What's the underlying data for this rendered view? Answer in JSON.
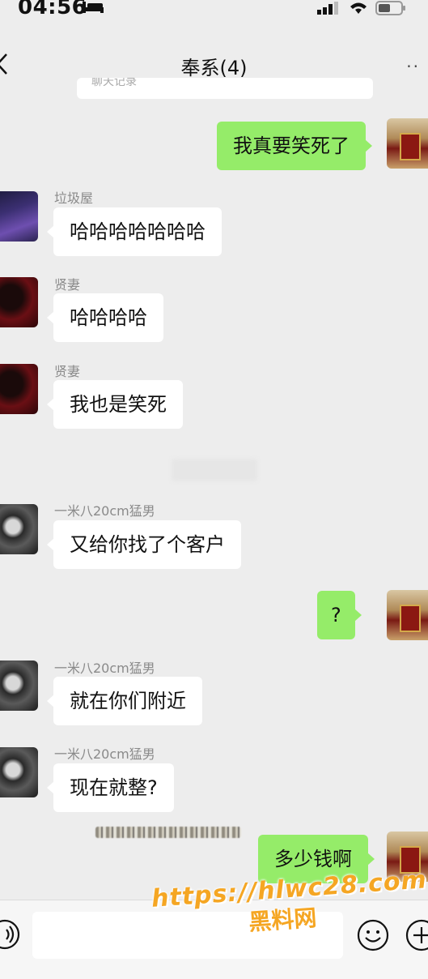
{
  "status_bar": {
    "time": "04:56"
  },
  "nav": {
    "title": "奉系(4)"
  },
  "partial_card_text": "聊天记录",
  "messages": [
    {
      "direction": "out",
      "text": "我真要笑死了"
    },
    {
      "direction": "in",
      "sender": "垃圾屋",
      "text": "哈哈哈哈哈哈哈"
    },
    {
      "direction": "in",
      "sender": "贤妻",
      "text": "哈哈哈哈"
    },
    {
      "direction": "in",
      "sender": "贤妻",
      "text": "我也是笑死"
    },
    {
      "direction": "in",
      "sender": "一米八20cm猛男",
      "text": "又给你找了个客户"
    },
    {
      "direction": "out",
      "text": "?"
    },
    {
      "direction": "in",
      "sender": "一米八20cm猛男",
      "text": "就在你们附近"
    },
    {
      "direction": "in",
      "sender": "一米八20cm猛男",
      "text": "现在就整?"
    },
    {
      "direction": "out",
      "text": "多少钱啊"
    }
  ],
  "watermark": {
    "url": "https://hlwc28.com",
    "name": "黑料网"
  },
  "icons": {
    "back": "chevron-left-icon",
    "more": "more-icon",
    "voice": "voice-icon",
    "emoji": "emoji-icon",
    "plus": "plus-icon"
  },
  "colors": {
    "background": "#ededed",
    "outgoing_bubble": "#95ec69",
    "incoming_bubble": "#ffffff",
    "watermark": "#f5a623"
  }
}
